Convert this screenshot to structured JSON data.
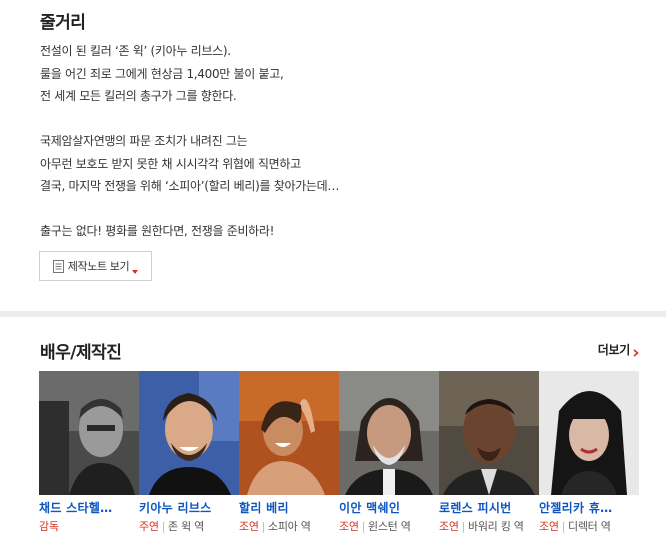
{
  "synopsis": {
    "title": "줄거리",
    "lines": [
      "전설이 된 킬러 ‘존 윅’ (키아누 리브스).",
      " 룰을 어긴 죄로 그에게 현상금 1,400만 불이 붙고,",
      " 전 세계 모든 킬러의 총구가 그를 향한다.",
      "",
      " 국제암살자연맹의 파문 조치가 내려진 그는",
      " 아무런 보호도 받지 못한 채 시시각각 위협에 직면하고",
      " 결국, 마지막 전쟁을 위해 ‘소피아’(할리 베리)를 찾아가는데…",
      "",
      " 출구는 없다! 평화를 원한다면, 전쟁을 준비하라!"
    ],
    "note_button_label": "제작노트 보기"
  },
  "cast": {
    "title": "배우/제작진",
    "more_label": "더보기",
    "items": [
      {
        "name": "채드 스타헬…",
        "kind": "감독",
        "role": ""
      },
      {
        "name": "키아누 리브스",
        "kind": "주연",
        "role": "존 윅 역"
      },
      {
        "name": "할리 베리",
        "kind": "조연",
        "role": "소피아 역"
      },
      {
        "name": "이안 맥쉐인",
        "kind": "조연",
        "role": "윈스턴 역"
      },
      {
        "name": "로렌스 피시번",
        "kind": "조연",
        "role": "바워리 킹 역"
      },
      {
        "name": "안젤리카 휴…",
        "kind": "조연",
        "role": "디렉터 역"
      }
    ]
  },
  "colors": {
    "link_blue": "#0c56c4",
    "role_red": "#d9321f",
    "divider_gray": "#ededed"
  },
  "icons": {
    "note_button": "document-icon",
    "note_arrow": "caret-down-icon",
    "more_arrow": "chevron-right-icon"
  }
}
